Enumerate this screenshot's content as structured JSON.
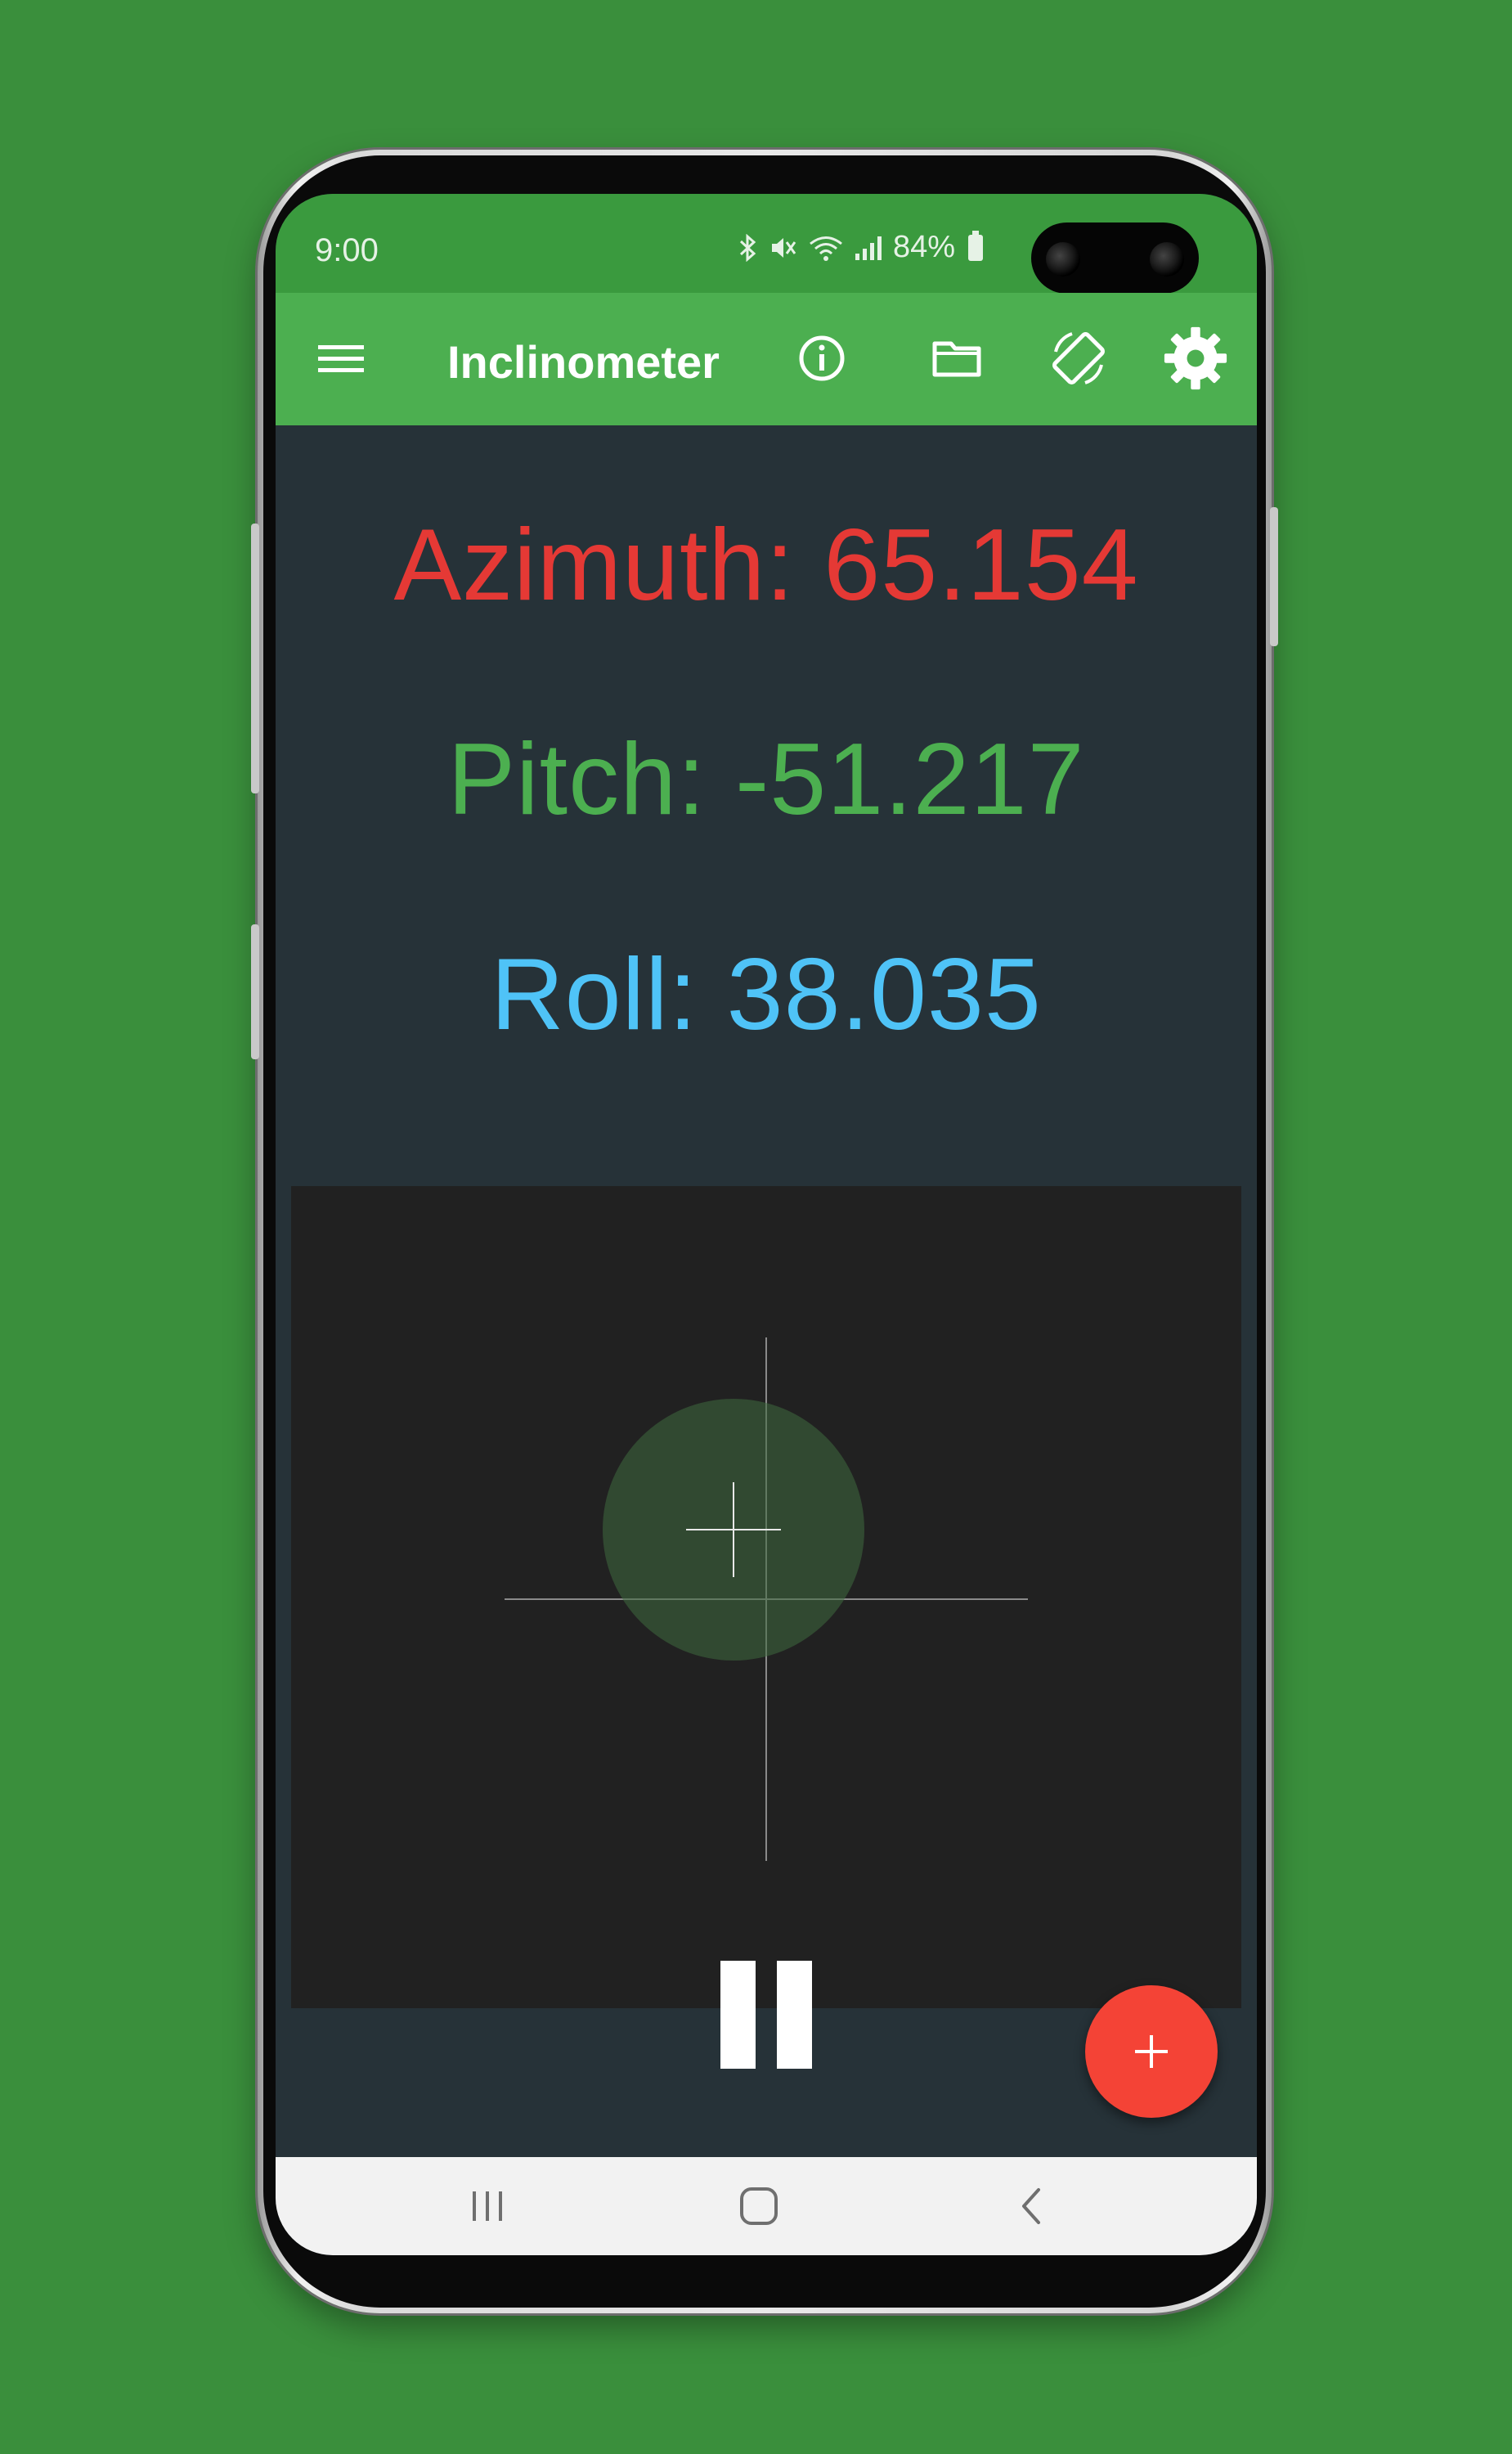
{
  "status_bar": {
    "time": "9:00",
    "battery": "84%",
    "icons": [
      "bluetooth-icon",
      "mute-icon",
      "wifi-icon",
      "signal-icon",
      "battery-icon"
    ]
  },
  "app_bar": {
    "title": "Inclinometer",
    "icons": [
      "menu-icon",
      "info-icon",
      "folder-icon",
      "screen-rotation-icon",
      "settings-icon"
    ]
  },
  "readings": {
    "azimuth": "Azimuth: 65.154",
    "pitch": "Pitch: -51.217",
    "roll": "Roll: 38.035"
  },
  "controls": {
    "pause_icon": "pause-icon",
    "fab_icon": "plus-icon"
  },
  "nav_bar": {
    "icons": [
      "recent-apps-icon",
      "home-icon",
      "back-icon"
    ]
  },
  "colors": {
    "background": "#3a8f3c",
    "status_bar": "#3a9a3e",
    "app_bar": "#4caf50",
    "panel": "#263238",
    "level_panel": "#212121",
    "azimuth": "#e53935",
    "pitch": "#4caf50",
    "roll": "#4fc3f7",
    "fab": "#f44336"
  }
}
